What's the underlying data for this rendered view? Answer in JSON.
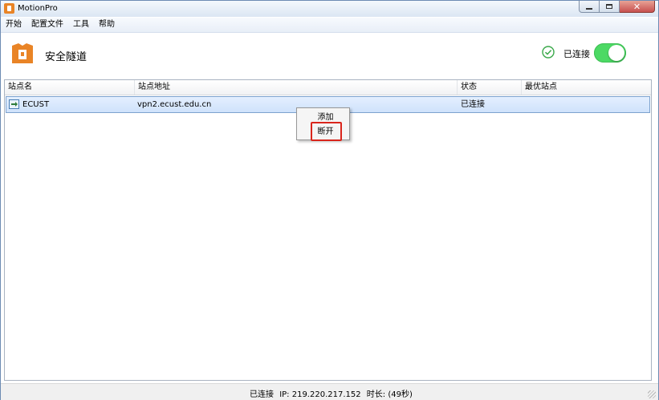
{
  "window": {
    "title": "MotionPro"
  },
  "menu": [
    "开始",
    "配置文件",
    "工具",
    "帮助"
  ],
  "header": {
    "title": "安全隧道",
    "connection_label": "已连接",
    "toggle_on": true,
    "accent": "#4cd964",
    "logo_color": "#e98426"
  },
  "table": {
    "columns": [
      "站点名",
      "站点地址",
      "状态",
      "最优站点"
    ],
    "rows": [
      {
        "name": "ECUST",
        "address": "vpn2.ecust.edu.cn",
        "status": "已连接",
        "best": ""
      }
    ]
  },
  "context_menu": {
    "items": [
      "添加",
      "断开"
    ],
    "highlighted": "断开",
    "highlight_color": "#d9251c"
  },
  "statusbar": {
    "state": "已连接",
    "ip": "IP: 219.220.217.152",
    "duration": "时长: (49秒)"
  },
  "icons": [
    "app-logo-icon",
    "minimize-icon",
    "maximize-icon",
    "close-icon",
    "check-circle-icon",
    "site-connect-icon",
    "resize-grip-icon"
  ]
}
